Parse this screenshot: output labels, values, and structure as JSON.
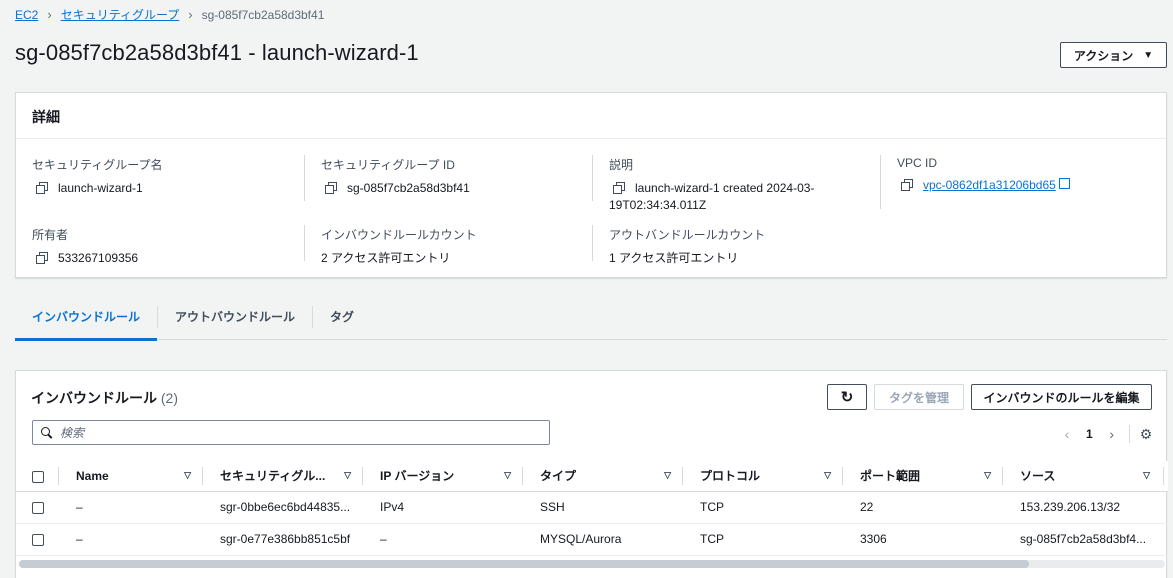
{
  "breadcrumb": {
    "root": "EC2",
    "parent": "セキュリティグループ",
    "current": "sg-085f7cb2a58d3bf41"
  },
  "page": {
    "title": "sg-085f7cb2a58d3bf41 - launch-wizard-1",
    "action_label": "アクション"
  },
  "details": {
    "header": "詳細",
    "group_name_label": "セキュリティグループ名",
    "group_name": "launch-wizard-1",
    "group_id_label": "セキュリティグループ ID",
    "group_id": "sg-085f7cb2a58d3bf41",
    "desc_label": "説明",
    "desc_line1": "launch-wizard-1 created 2024-03-",
    "desc_line2": "19T02:34:34.011Z",
    "vpc_label": "VPC ID",
    "vpc_id": "vpc-0862df1a31206bd65",
    "owner_label": "所有者",
    "owner": "533267109356",
    "inbound_count_label": "インバウンドルールカウント",
    "inbound_count": "2 アクセス許可エントリ",
    "outbound_count_label": "アウトバンドルールカウント",
    "outbound_count": "1 アクセス許可エントリ"
  },
  "tabs": [
    "インバウンドルール",
    "アウトバウンドルール",
    "タグ"
  ],
  "rules": {
    "title": "インバウンドルール",
    "count": "(2)",
    "manage_tags_label": "タグを管理",
    "edit_label": "インバウンドのルールを編集",
    "search_placeholder": "検索",
    "page": "1",
    "columns": [
      "Name",
      "セキュリティグル...",
      "IP バージョン",
      "タイプ",
      "プロトコル",
      "ポート範囲",
      "ソース"
    ],
    "rows": [
      [
        "–",
        "sgr-0bbe6ec6bd44835...",
        "IPv4",
        "SSH",
        "TCP",
        "22",
        "153.239.206.13/32"
      ],
      [
        "–",
        "sgr-0e77e386bb851c5bf",
        "–",
        "MYSQL/Aurora",
        "TCP",
        "3306",
        "sg-085f7cb2a58d3bf4..."
      ]
    ]
  },
  "colors": {
    "link": "#0972d3",
    "border": "#d5dbdb",
    "background": "#f2f3f3"
  }
}
